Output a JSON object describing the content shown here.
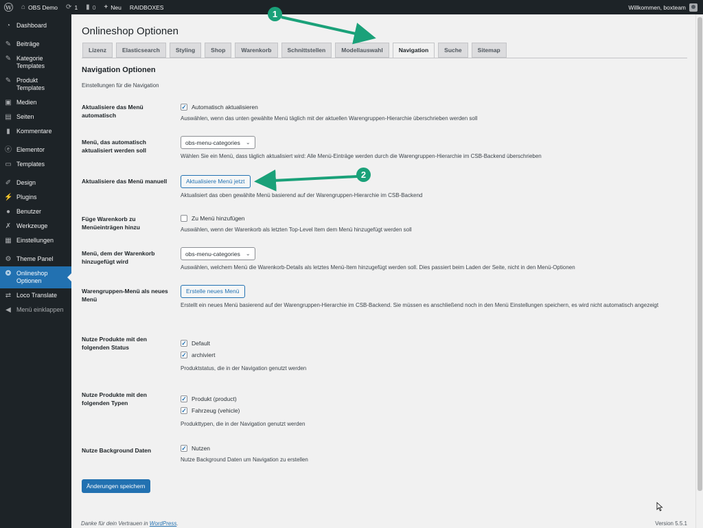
{
  "adminbar": {
    "site_name": "OBS Demo",
    "updates_count": "1",
    "comments_count": "0",
    "new_label": "Neu",
    "plugin_label": "RAIDBOXES",
    "welcome": "Willkommen, boxteam"
  },
  "sidebar": {
    "items": [
      {
        "label": "Dashboard",
        "icon": "dashboard-icon"
      },
      {
        "label": "Beiträge",
        "icon": "pin-icon"
      },
      {
        "label": "Kategorie Templates",
        "icon": "pin-icon"
      },
      {
        "label": "Produkt Templates",
        "icon": "pin-icon"
      },
      {
        "label": "Medien",
        "icon": "media-icon"
      },
      {
        "label": "Seiten",
        "icon": "pages-icon"
      },
      {
        "label": "Kommentare",
        "icon": "comments-icon"
      },
      {
        "label": "Elementor",
        "icon": "elementor-icon"
      },
      {
        "label": "Templates",
        "icon": "folder-icon"
      },
      {
        "label": "Design",
        "icon": "brush-icon"
      },
      {
        "label": "Plugins",
        "icon": "plugin-icon"
      },
      {
        "label": "Benutzer",
        "icon": "users-icon"
      },
      {
        "label": "Werkzeuge",
        "icon": "tools-icon"
      },
      {
        "label": "Einstellungen",
        "icon": "settings-icon"
      },
      {
        "label": "Theme Panel",
        "icon": "gear-icon"
      },
      {
        "label": "Onlineshop Optionen",
        "icon": "shop-icon"
      },
      {
        "label": "Loco Translate",
        "icon": "translate-icon"
      },
      {
        "label": "Menü einklappen",
        "icon": "collapse-icon"
      }
    ]
  },
  "page": {
    "title": "Onlineshop Optionen",
    "tabs": [
      "Lizenz",
      "Elasticsearch",
      "Styling",
      "Shop",
      "Warenkorb",
      "Schnittstellen",
      "Modellauswahl",
      "Navigation",
      "Suche",
      "Sitemap"
    ],
    "active_tab": "Navigation",
    "section_title": "Navigation Optionen",
    "section_desc": "Einstellungen für die Navigation"
  },
  "settings": {
    "auto_update": {
      "label": "Aktualisiere das Menü automatisch",
      "checkbox_label": "Automatisch aktualisieren",
      "checked": true,
      "desc": "Auswählen, wenn das unten gewählte Menü täglich mit der aktuellen Warengruppen-Hierarchie überschrieben werden soll"
    },
    "auto_menu": {
      "label": "Menü, das automatisch aktualisiert werden soll",
      "selected": "obs-menu-categories",
      "desc": "Wählen Sie ein Menü, dass täglich aktualisiert wird: Alle Menü-Einträge werden durch die Warengruppen-Hierarchie im CSB-Backend überschrieben"
    },
    "manual_update": {
      "label": "Aktualisiere das Menü manuell",
      "button": "Aktualisiere Menü jetzt",
      "desc": "Aktualisiert das oben gewählte Menü basierend auf der Warengruppen-Hierarchie im CSB-Backend"
    },
    "add_cart": {
      "label": "Füge Warenkorb zu Menüeinträgen hinzu",
      "checkbox_label": "Zu Menü hinzufügen",
      "checked": false,
      "desc": "Auswählen, wenn der Warenkorb als letzten Top-Level Item dem Menü hinzugefügt werden soll"
    },
    "cart_menu": {
      "label": "Menü, dem der Warenkorb hinzugefügt wird",
      "selected": "obs-menu-categories",
      "desc": "Auswählen, welchem Menü die Warenkorb-Details als letztes Menü-Item hinzugefügt werden soll. Dies passiert beim Laden der Seite, nicht in den Menü-Optionen"
    },
    "new_menu": {
      "label": "Warengruppen-Menü als neues Menü",
      "button": "Erstelle neues Menü",
      "desc": "Erstellt ein neues Menü basierend auf der Warengruppen-Hierarchie im CSB-Backend. Sie müssen es anschließend noch in den Menü Einstellungen speichern, es wird nicht automatisch angezeigt"
    },
    "product_status": {
      "label": "Nutze Produkte mit den folgenden Status",
      "options": [
        {
          "label": "Default",
          "checked": true
        },
        {
          "label": "archiviert",
          "checked": true
        }
      ],
      "desc": "Produktstatus, die in der Navigation genutzt werden"
    },
    "product_types": {
      "label": "Nutze Produkte mit den folgenden Typen",
      "options": [
        {
          "label": "Produkt (product)",
          "checked": true
        },
        {
          "label": "Fahrzeug (vehicle)",
          "checked": true
        }
      ],
      "desc": "Produkttypen, die in der Navigation genutzt werden"
    },
    "background": {
      "label": "Nutze Background Daten",
      "checkbox_label": "Nutzen",
      "checked": true,
      "desc": "Nutze Background Daten um Navigation zu erstellen"
    }
  },
  "save_button": "Änderungen speichern",
  "footer": {
    "thanks_prefix": "Danke für dein Vertrauen in ",
    "thanks_link": "WordPress",
    "thanks_suffix": ".",
    "version": "Version 5.5.1"
  },
  "annotations": [
    "1",
    "2"
  ],
  "colors": {
    "accent": "#2271b1",
    "callout": "#1aa179",
    "adminbar": "#1d2327"
  }
}
